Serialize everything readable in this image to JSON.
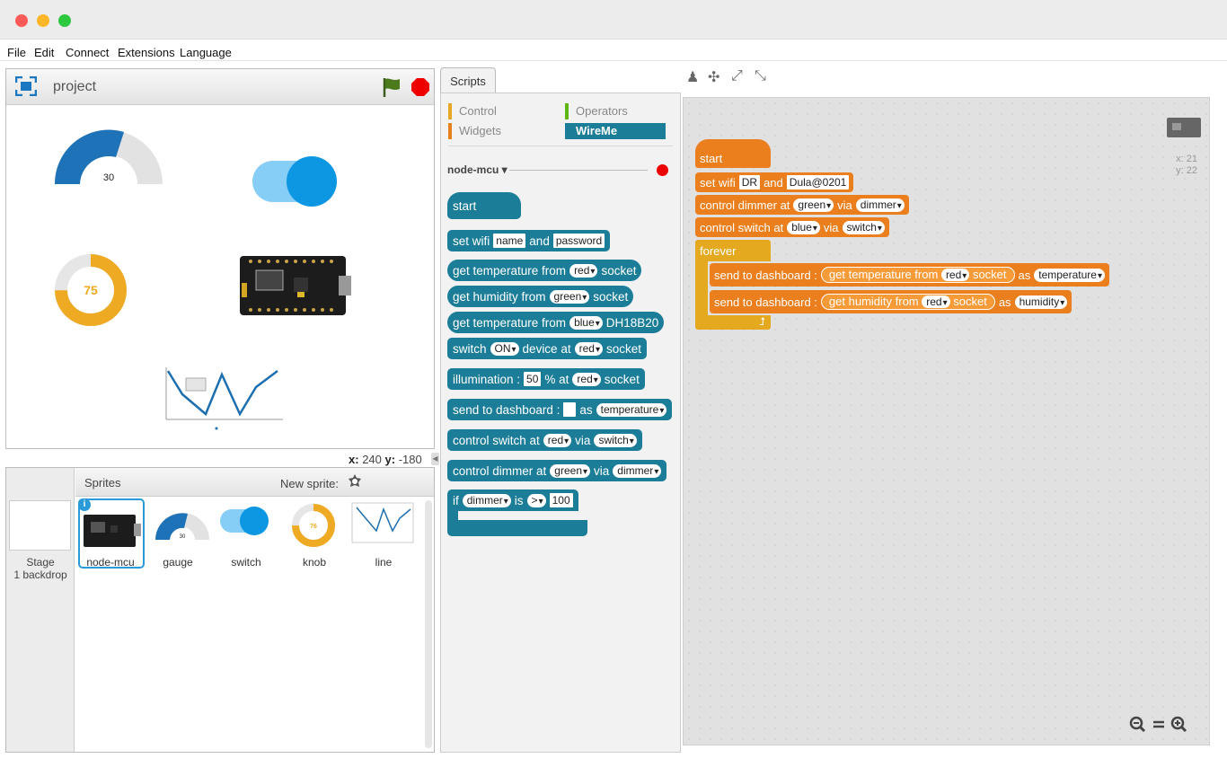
{
  "menu": [
    "File",
    "Edit",
    "Connect",
    "Extensions",
    "Language"
  ],
  "stage": {
    "project_name": "project",
    "coords_x_label": "x:",
    "coords_x": "240",
    "coords_y_label": "y:",
    "coords_y": "-180"
  },
  "widgets": {
    "gauge_value": "30",
    "knob_value": "75"
  },
  "sprites": {
    "header": "Sprites",
    "new_sprite": "New sprite:",
    "stage_label": "Stage",
    "stage_backdrops": "1 backdrop",
    "items": [
      "node-mcu",
      "gauge",
      "switch",
      "knob",
      "line"
    ],
    "thumb_gauge_value": "30",
    "thumb_knob_value": "76"
  },
  "scripts_tab": "Scripts",
  "palette": {
    "categories": [
      "Control",
      "Operators",
      "Widgets",
      "WireMe"
    ],
    "device": "node-mcu ▾",
    "blocks": {
      "start": "start",
      "setwifi": {
        "label": "set wifi",
        "name": "name",
        "and": "and",
        "password": "password"
      },
      "gettemp": {
        "label": "get temperature from",
        "port": "red",
        "socket": "socket"
      },
      "gethum": {
        "label": "get humidity from",
        "port": "green",
        "socket": "socket"
      },
      "gettemp2": {
        "label": "get temperature from",
        "port": "blue",
        "sensor": "DH18B20"
      },
      "switch": {
        "label": "switch",
        "state": "ON",
        "device": "device at",
        "port": "red",
        "socket": "socket"
      },
      "illum": {
        "label": "illumination :",
        "value": "50",
        "pct": "% at",
        "port": "red",
        "socket": "socket"
      },
      "send": {
        "label": "send to dashboard :",
        "as": "as",
        "widget": "temperature"
      },
      "ctrlswitch": {
        "label": "control switch at",
        "port": "red",
        "via": "via",
        "widget": "switch"
      },
      "ctrldimmer": {
        "label": "control dimmer at",
        "port": "green",
        "via": "via",
        "widget": "dimmer"
      },
      "if": {
        "label": "if",
        "var": "dimmer",
        "is": "is",
        "op": ">",
        "value": "100"
      }
    }
  },
  "script": {
    "start": "start",
    "setwifi": {
      "label": "set wifi",
      "ssid": "DR",
      "and": "and",
      "pass": "Dula@0201"
    },
    "ctrldimmer": {
      "label": "control dimmer at",
      "port": "green",
      "via": "via",
      "widget": "dimmer"
    },
    "ctrlswitch": {
      "label": "control switch at",
      "port": "blue",
      "via": "via",
      "widget": "switch"
    },
    "forever": "forever",
    "send1": {
      "label": "send to dashboard :",
      "inner": "get temperature from",
      "port": "red",
      "socket": "socket",
      "as": "as",
      "widget": "temperature"
    },
    "send2": {
      "label": "send to dashboard :",
      "inner": "get humidity from",
      "port": "red",
      "socket": "socket",
      "as": "as",
      "widget": "humidity"
    },
    "xy_x": "x: 21",
    "xy_y": "y: 22"
  }
}
